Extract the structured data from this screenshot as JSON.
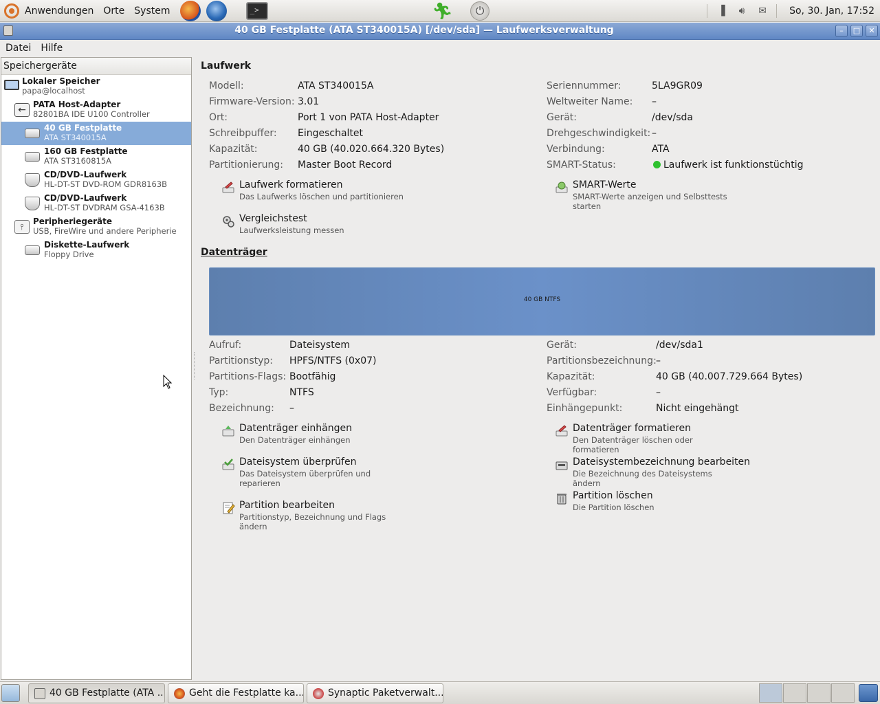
{
  "top_panel": {
    "menus": [
      "Anwendungen",
      "Orte",
      "System"
    ],
    "clock": "So, 30. Jan, 17:52"
  },
  "window": {
    "title": "40 GB Festplatte (ATA ST340015A) [/dev/sda] — Laufwerksverwaltung"
  },
  "menubar": {
    "file": "Datei",
    "help": "Hilfe"
  },
  "sidebar": {
    "header": "Speichergeräte",
    "items": [
      {
        "title": "Lokaler Speicher",
        "subtitle": "papa@localhost"
      },
      {
        "title": "PATA Host-Adapter",
        "subtitle": "82801BA IDE U100 Controller"
      },
      {
        "title": "40 GB Festplatte",
        "subtitle": "ATA ST340015A"
      },
      {
        "title": "160 GB Festplatte",
        "subtitle": "ATA ST3160815A"
      },
      {
        "title": "CD/DVD-Laufwerk",
        "subtitle": "HL-DT-ST DVD-ROM GDR8163B"
      },
      {
        "title": "CD/DVD-Laufwerk",
        "subtitle": "HL-DT-ST DVDRAM GSA-4163B"
      },
      {
        "title": "Peripheriegeräte",
        "subtitle": "USB, FireWire und andere Peripherie"
      },
      {
        "title": "Diskette-Laufwerk",
        "subtitle": "Floppy Drive"
      }
    ]
  },
  "drive": {
    "section_title": "Laufwerk",
    "left": [
      {
        "label": "Modell:",
        "value": "ATA ST340015A"
      },
      {
        "label": "Firmware-Version:",
        "value": "3.01"
      },
      {
        "label": "Ort:",
        "value": "Port 1 von PATA Host-Adapter"
      },
      {
        "label": "Schreibpuffer:",
        "value": "Eingeschaltet"
      },
      {
        "label": "Kapazität:",
        "value": "40 GB (40.020.664.320 Bytes)"
      },
      {
        "label": "Partitionierung:",
        "value": "Master Boot Record"
      }
    ],
    "right": [
      {
        "label": "Seriennummer:",
        "value": "5LA9GR09"
      },
      {
        "label": "Weltweiter Name:",
        "value": "–"
      },
      {
        "label": "Gerät:",
        "value": "/dev/sda"
      },
      {
        "label": "Drehgeschwindigkeit:",
        "value": "–"
      },
      {
        "label": "Verbindung:",
        "value": "ATA"
      },
      {
        "label": "SMART-Status:",
        "value": "Laufwerk ist funktionstüchtig"
      }
    ],
    "actions": {
      "format": {
        "label": "Laufwerk formatieren",
        "desc": "Das Laufwerks löschen und partitionieren"
      },
      "smart": {
        "label": "SMART-Werte",
        "desc": "SMART-Werte anzeigen und Selbsttests starten"
      },
      "benchmark": {
        "label": "Vergleichstest",
        "desc": "Laufwerksleistung messen"
      }
    }
  },
  "volumes": {
    "section_title": "Datenträger",
    "partition_label": "40 GB NTFS",
    "left": [
      {
        "label": "Aufruf:",
        "value": "Dateisystem"
      },
      {
        "label": "Partitionstyp:",
        "value": "HPFS/NTFS (0x07)"
      },
      {
        "label": "Partitions-Flags:",
        "value": "Bootfähig"
      },
      {
        "label": "Typ:",
        "value": "NTFS"
      },
      {
        "label": "Bezeichnung:",
        "value": "–"
      }
    ],
    "right": [
      {
        "label": "Gerät:",
        "value": "/dev/sda1"
      },
      {
        "label": "Partitionsbezeichnung:",
        "value": "–"
      },
      {
        "label": "Kapazität:",
        "value": "40 GB (40.007.729.664 Bytes)"
      },
      {
        "label": "Verfügbar:",
        "value": "–"
      },
      {
        "label": "Einhängepunkt:",
        "value": "Nicht eingehängt"
      }
    ],
    "actions": {
      "mount": {
        "label": "Datenträger einhängen",
        "desc": "Den Datenträger einhängen"
      },
      "format": {
        "label": "Datenträger formatieren",
        "desc": "Den Datenträger löschen oder formatieren"
      },
      "check": {
        "label": "Dateisystem überprüfen",
        "desc": "Das Dateisystem überprüfen und reparieren"
      },
      "edit_label": {
        "label": "Dateisystembezeichnung bearbeiten",
        "desc": "Die Bezeichnung des Dateisystems ändern"
      },
      "edit_partition": {
        "label": "Partition bearbeiten",
        "desc": "Partitionstyp, Bezeichnung und Flags ändern"
      },
      "delete": {
        "label": "Partition löschen",
        "desc": "Die Partition löschen"
      }
    }
  },
  "taskbar": {
    "tasks": [
      "40 GB Festplatte (ATA ...",
      "Geht die Festplatte ka...",
      "Synaptic Paketverwalt..."
    ]
  },
  "colors": {
    "titlebar": "#6f93cc",
    "selection": "#86abd9",
    "partition": "#6b91c9",
    "smart_ok": "#2ec12e"
  }
}
